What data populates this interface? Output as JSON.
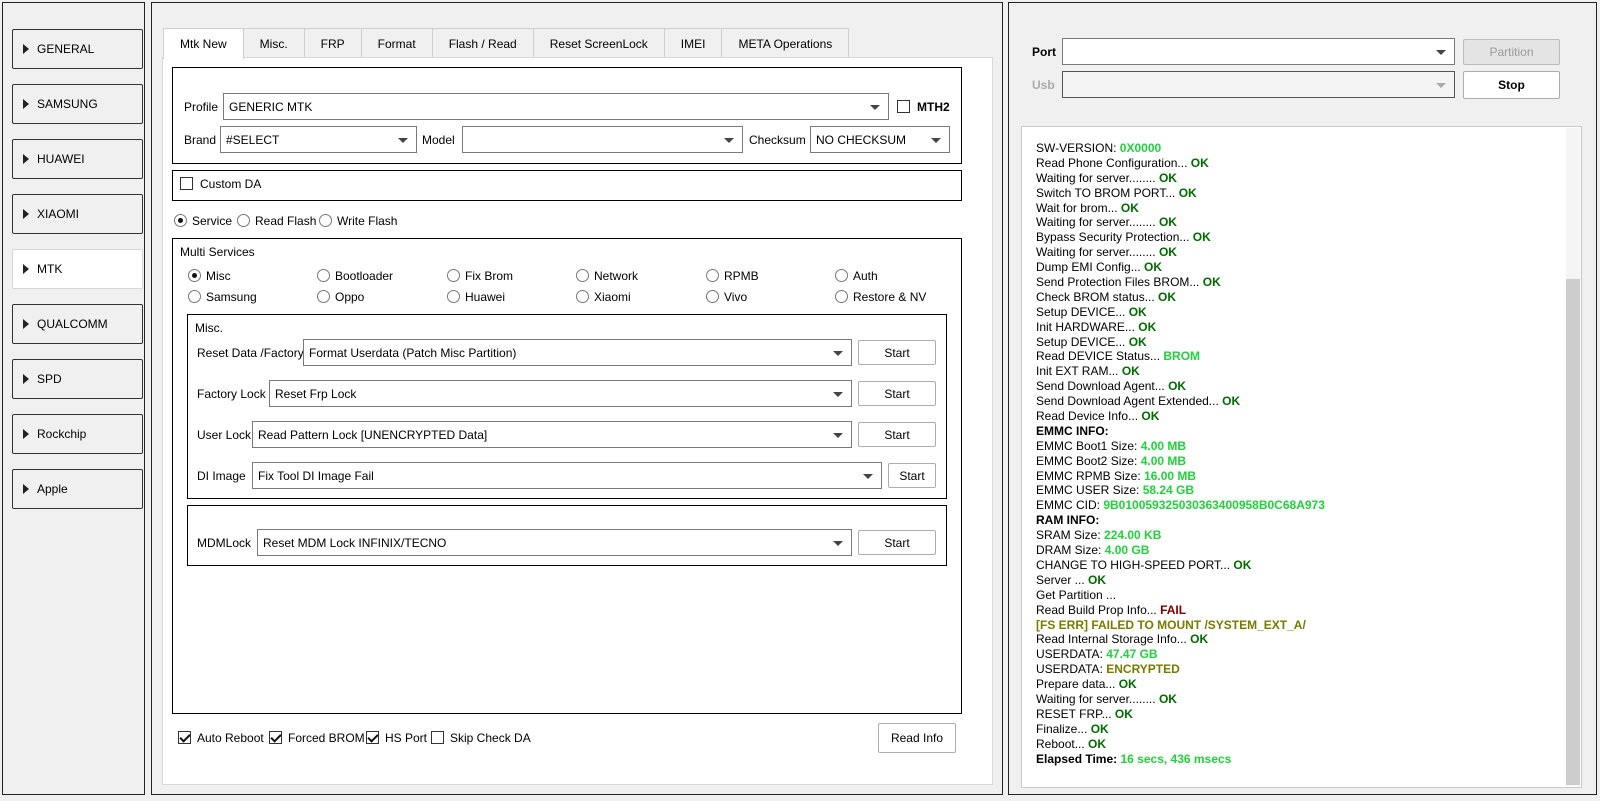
{
  "sidebar": {
    "items": [
      {
        "label": "GENERAL",
        "active": false
      },
      {
        "label": "SAMSUNG",
        "active": false
      },
      {
        "label": "HUAWEI",
        "active": false
      },
      {
        "label": "XIAOMI",
        "active": false
      },
      {
        "label": "MTK",
        "active": true
      },
      {
        "label": "QUALCOMM",
        "active": false
      },
      {
        "label": "SPD",
        "active": false
      },
      {
        "label": "Rockchip",
        "active": false
      },
      {
        "label": "Apple",
        "active": false
      }
    ]
  },
  "tabs": [
    "Mtk New",
    "Misc.",
    "FRP",
    "Format",
    "Flash / Read",
    "Reset ScreenLock",
    "IMEI",
    "META Operations"
  ],
  "active_tab": "Mtk New",
  "profile": {
    "label": "Profile",
    "value": "GENERIC MTK",
    "mth2_label": "MTH2",
    "mth2_checked": false,
    "brand_label": "Brand",
    "brand_value": "#SELECT",
    "model_label": "Model",
    "model_value": "",
    "checksum_label": "Checksum",
    "checksum_value": "NO CHECKSUM"
  },
  "custom_da": {
    "label": "Custom DA",
    "checked": false
  },
  "mode": {
    "options": [
      "Service",
      "Read Flash",
      "Write Flash"
    ],
    "selected": "Service"
  },
  "multi_services": {
    "title": "Multi Services",
    "row1": [
      "Misc",
      "Bootloader",
      "Fix Brom",
      "Network",
      "RPMB",
      "Auth"
    ],
    "row2": [
      "Samsung",
      "Oppo",
      "Huawei",
      "Xiaomi",
      "Vivo",
      "Restore & NV"
    ],
    "selected": "Misc"
  },
  "misc": {
    "title": "Misc.",
    "rows": [
      {
        "label": "Reset Data /Factory",
        "value": "Format Userdata (Patch Misc Partition)",
        "button": "Start"
      },
      {
        "label": "Factory Lock",
        "value": "Reset Frp Lock",
        "button": "Start"
      },
      {
        "label": "User Lock",
        "value": "Read Pattern Lock [UNENCRYPTED Data]",
        "button": "Start"
      },
      {
        "label": "DI Image",
        "value": "Fix Tool DI Image Fail",
        "button": "Start"
      }
    ]
  },
  "mdm": {
    "label": "MDMLock",
    "value": "Reset MDM Lock INFINIX/TECNO",
    "button": "Start"
  },
  "options": [
    {
      "label": "Auto Reboot",
      "checked": true
    },
    {
      "label": "Forced BROM",
      "checked": true
    },
    {
      "label": "HS Port",
      "checked": true
    },
    {
      "label": "Skip Check DA",
      "checked": false
    }
  ],
  "read_info_button": "Read Info",
  "port": {
    "port_label": "Port",
    "port_value": "",
    "usb_label": "Usb",
    "usb_value": "",
    "partition_button": "Partition",
    "stop_button": "Stop"
  },
  "colors": {
    "ok": "#006b00",
    "value": "#1fd23a",
    "fail": "#7a0000",
    "warn": "#7a7a00"
  },
  "log": [
    {
      "text": "SW-VERSION: ",
      "value": "0X0000",
      "style": "hi"
    },
    {
      "text": "Read Phone Configuration... ",
      "value": "OK",
      "style": "ok"
    },
    {
      "text": "Waiting for server........ ",
      "value": "OK",
      "style": "ok"
    },
    {
      "text": "Switch TO BROM PORT... ",
      "value": "OK",
      "style": "ok"
    },
    {
      "text": "Wait for brom... ",
      "value": "OK",
      "style": "ok"
    },
    {
      "text": "Waiting for server........ ",
      "value": "OK",
      "style": "ok"
    },
    {
      "text": "Bypass Security Protection... ",
      "value": "OK",
      "style": "ok"
    },
    {
      "text": "Waiting for server........ ",
      "value": "OK",
      "style": "ok"
    },
    {
      "text": "Dump EMI Config... ",
      "value": "OK",
      "style": "ok"
    },
    {
      "text": "Send Protection Files BROM... ",
      "value": "OK",
      "style": "ok"
    },
    {
      "text": "Check BROM status... ",
      "value": "OK",
      "style": "ok"
    },
    {
      "text": "Setup DEVICE... ",
      "value": "OK",
      "style": "ok"
    },
    {
      "text": "Init HARDWARE... ",
      "value": "OK",
      "style": "ok"
    },
    {
      "text": "Setup DEVICE... ",
      "value": "OK",
      "style": "ok"
    },
    {
      "text": "Read DEVICE Status... ",
      "value": "BROM",
      "style": "hi"
    },
    {
      "text": "Init EXT RAM... ",
      "value": "OK",
      "style": "ok"
    },
    {
      "text": "Send Download Agent... ",
      "value": "OK",
      "style": "ok"
    },
    {
      "text": "Send Download Agent Extended... ",
      "value": "OK",
      "style": "ok"
    },
    {
      "text": "Read Device Info... ",
      "value": "OK",
      "style": "ok"
    },
    {
      "text": "",
      "value": "EMMC INFO:",
      "style": "bold"
    },
    {
      "text": "EMMC Boot1 Size: ",
      "value": "4.00 MB",
      "style": "hi"
    },
    {
      "text": "EMMC Boot2 Size: ",
      "value": "4.00 MB",
      "style": "hi"
    },
    {
      "text": "EMMC RPMB Size: ",
      "value": "16.00 MB",
      "style": "hi"
    },
    {
      "text": "EMMC USER Size: ",
      "value": "58.24 GB",
      "style": "hi"
    },
    {
      "text": "EMMC CID: ",
      "value": "9B01005932503036340095​8B0C68A973",
      "style": "hi"
    },
    {
      "text": "",
      "value": "RAM INFO:",
      "style": "bold"
    },
    {
      "text": "SRAM Size: ",
      "value": "224.00 KB",
      "style": "hi"
    },
    {
      "text": "DRAM Size: ",
      "value": "4.00 GB",
      "style": "hi"
    },
    {
      "text": "CHANGE TO HIGH-SPEED PORT... ",
      "value": "OK",
      "style": "ok"
    },
    {
      "text": "Server ... ",
      "value": "OK",
      "style": "ok"
    },
    {
      "text": "Get Partition ...",
      "value": "",
      "style": "ok"
    },
    {
      "text": "Read Build Prop Info... ",
      "value": "FAIL",
      "style": "fail"
    },
    {
      "text": "   ",
      "value": "[FS ERR] FAILED TO MOUNT /SYSTEM_EXT_A/",
      "style": "warn"
    },
    {
      "text": "Read Internal Storage Info... ",
      "value": "OK",
      "style": "ok"
    },
    {
      "text": "USERDATA: ",
      "value": "47.47 GB",
      "style": "hi"
    },
    {
      "text": "USERDATA: ",
      "value": "ENCRYPTED",
      "style": "warn"
    },
    {
      "text": "Prepare data... ",
      "value": "OK",
      "style": "ok"
    },
    {
      "text": "Waiting for server........ ",
      "value": "OK",
      "style": "ok"
    },
    {
      "text": "RESET FRP... ",
      "value": "OK",
      "style": "ok"
    },
    {
      "text": "Finalize... ",
      "value": "OK",
      "style": "ok"
    },
    {
      "text": "Reboot... ",
      "value": "OK",
      "style": "ok"
    },
    {
      "text": "Elapsed Time: ",
      "value": "16 secs, 436 msecs",
      "style": "hi",
      "label_bold": true
    }
  ]
}
